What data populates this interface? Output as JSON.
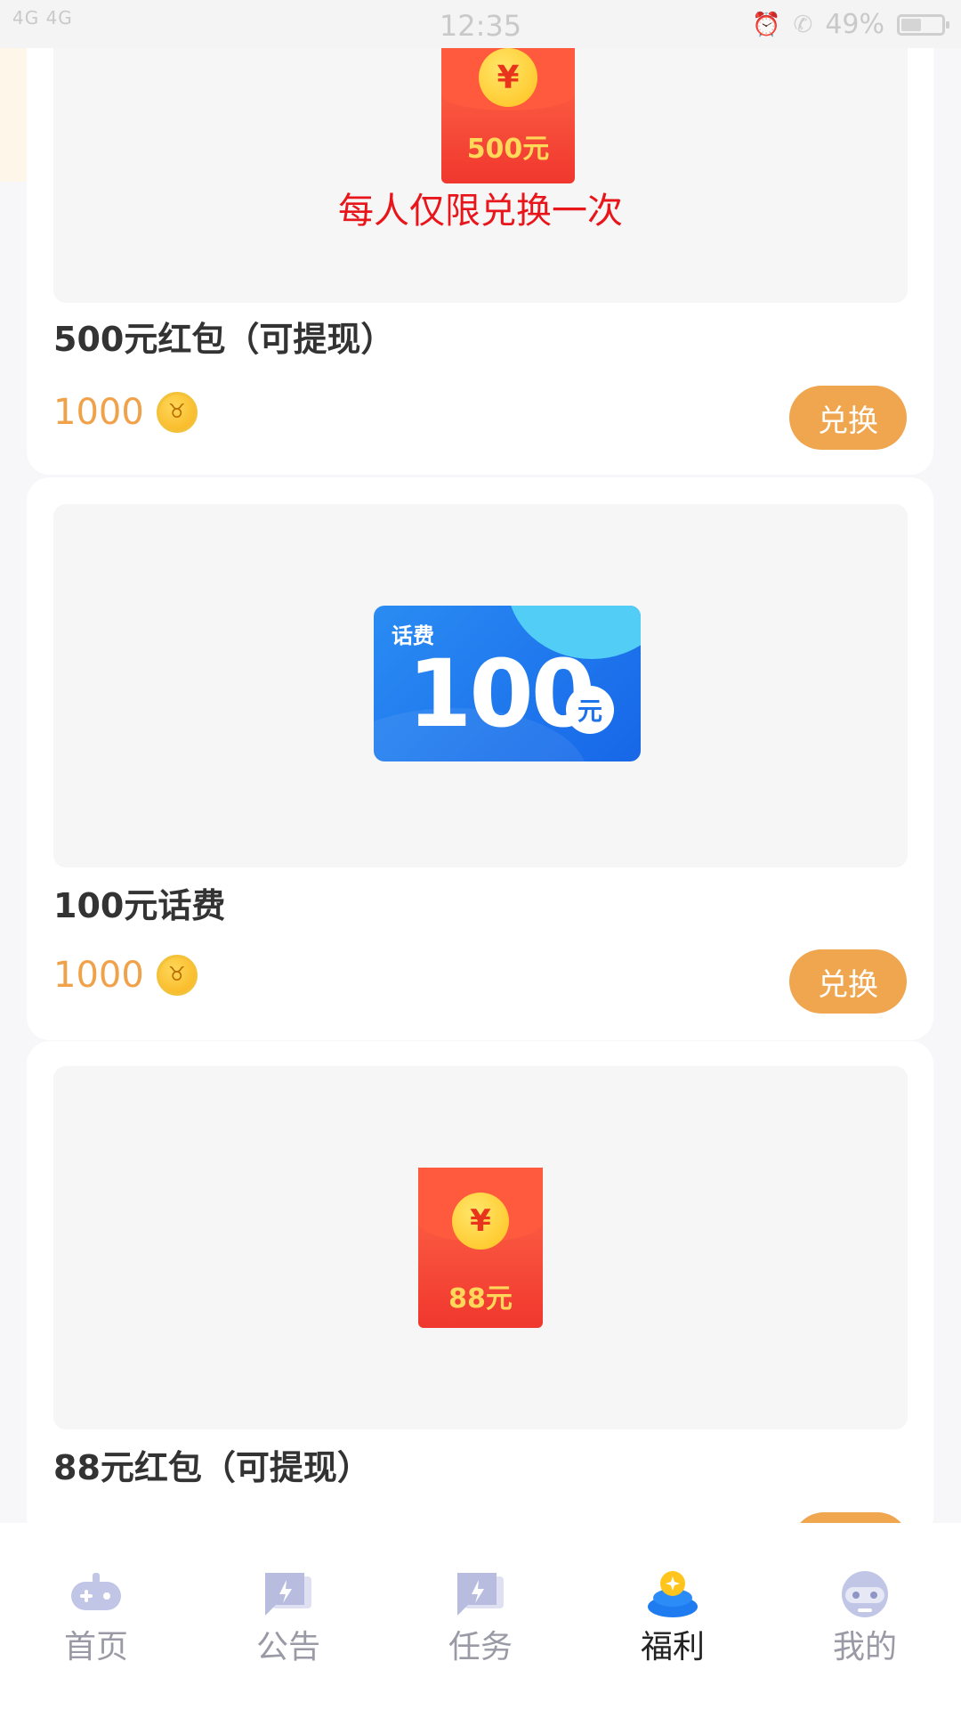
{
  "status_bar": {
    "signal": "4G 4G",
    "time": "12:35",
    "battery": "49%"
  },
  "items": [
    {
      "name": "500元红包（可提现）",
      "price": "1000",
      "button": "兑换",
      "envelope_amount": "500元",
      "yuan_symbol": "¥",
      "limit_note": "每人仅限兑换一次"
    },
    {
      "name": "100元话费",
      "price": "1000",
      "button": "兑换",
      "card_label": "话费",
      "card_amount": "100",
      "card_unit": "元"
    },
    {
      "name": "88元红包（可提现）",
      "envelope_amount": "88元",
      "yuan_symbol": "¥"
    }
  ],
  "nav": [
    {
      "label": "首页",
      "icon": "gamepad-icon"
    },
    {
      "label": "公告",
      "icon": "announcement-icon"
    },
    {
      "label": "任务",
      "icon": "task-icon"
    },
    {
      "label": "福利",
      "icon": "welfare-icon",
      "active": true
    },
    {
      "label": "我的",
      "icon": "robot-profile-icon"
    }
  ],
  "colors": {
    "accent": "#f0a64e",
    "price": "#f0a24a",
    "limit_note": "#e8151b",
    "nav_active": "#222222",
    "nav_inactive": "#9a9aa6"
  }
}
